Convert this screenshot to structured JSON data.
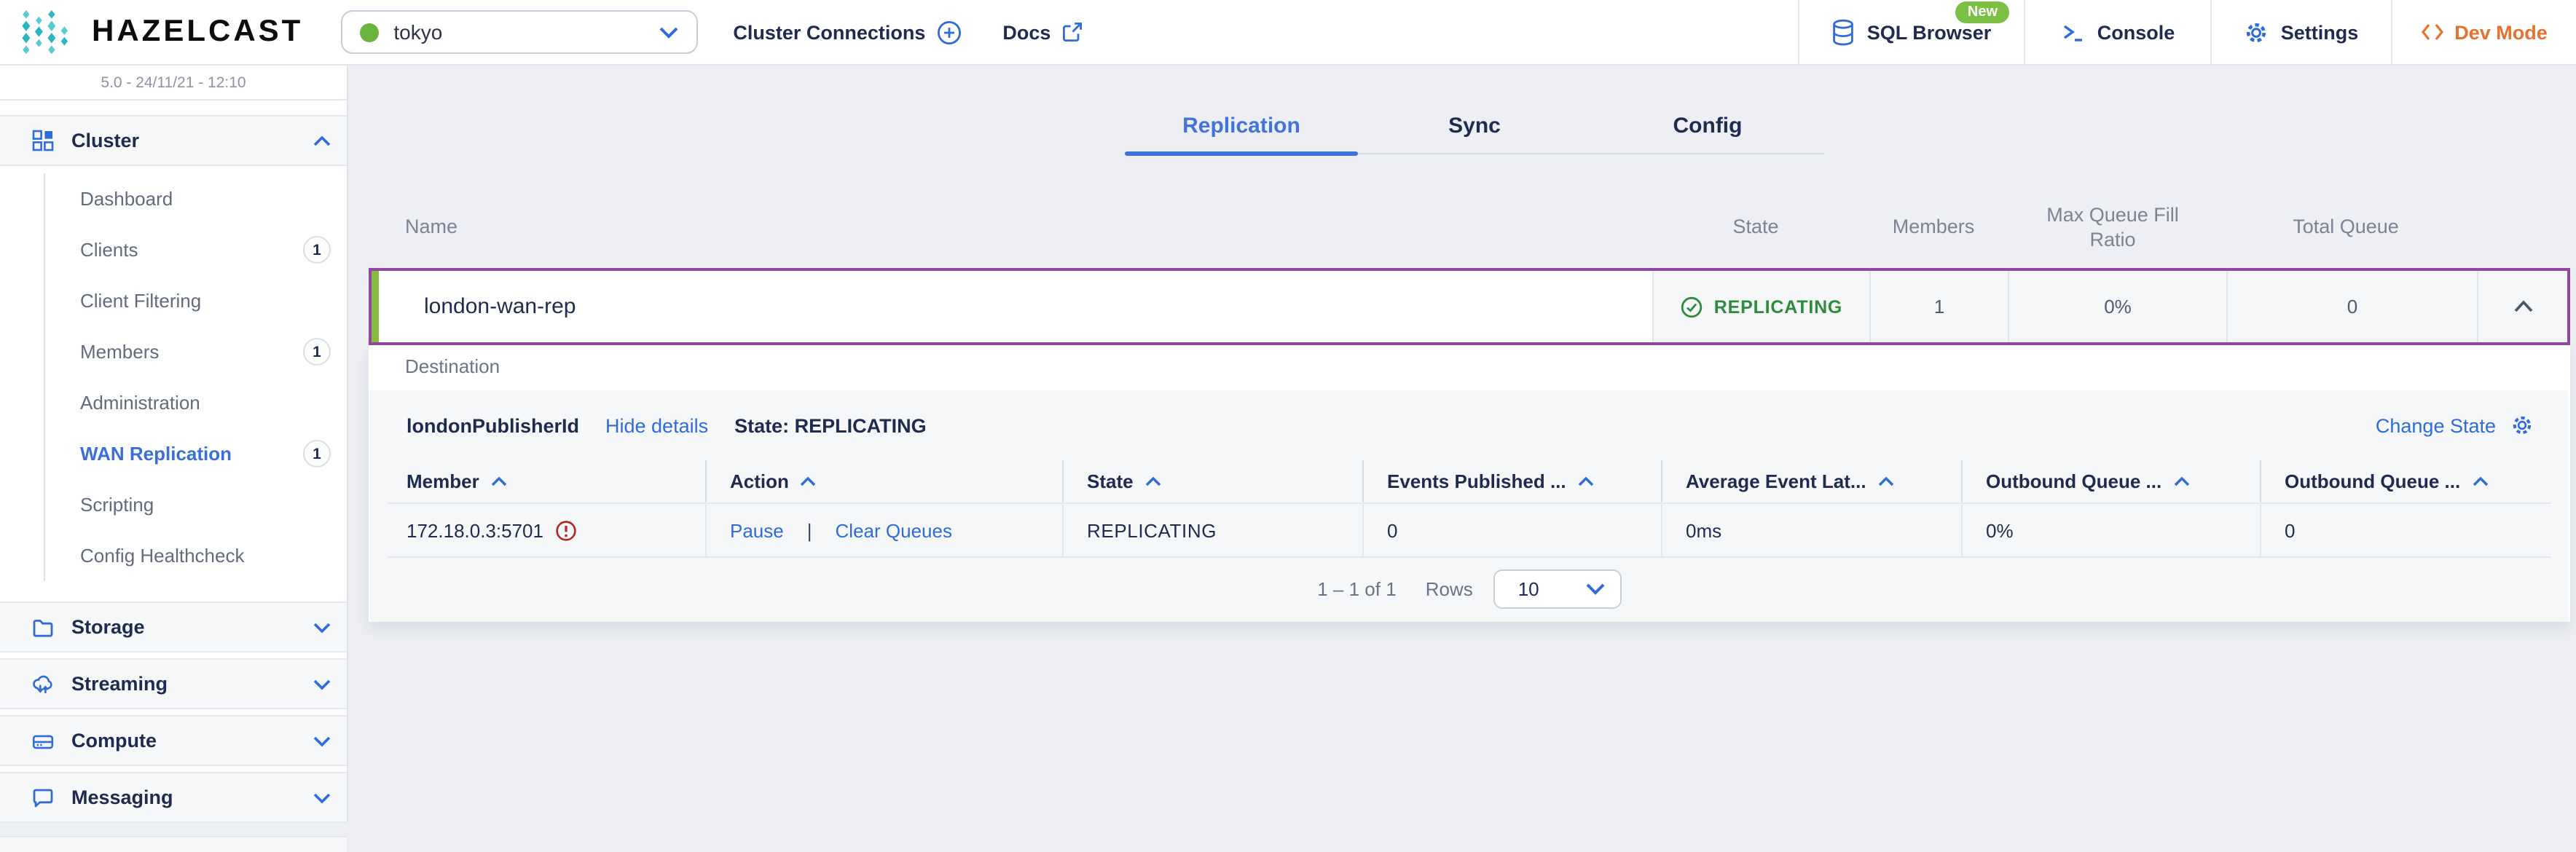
{
  "topbar": {
    "brand": "HAZELCAST",
    "cluster_selector": {
      "value": "tokyo",
      "status_color": "#6cb33e"
    },
    "cluster_connections": "Cluster Connections",
    "docs": "Docs",
    "actions": {
      "sql_browser": "SQL Browser",
      "sql_browser_badge": "New",
      "console": "Console",
      "settings": "Settings",
      "dev_mode": "Dev Mode"
    }
  },
  "sidebar": {
    "version": "5.0 - 24/11/21 - 12:10",
    "cluster_group": {
      "label": "Cluster",
      "items": [
        {
          "label": "Dashboard"
        },
        {
          "label": "Clients",
          "badge": "1"
        },
        {
          "label": "Client Filtering"
        },
        {
          "label": "Members",
          "badge": "1"
        },
        {
          "label": "Administration"
        },
        {
          "label": "WAN Replication",
          "badge": "1"
        },
        {
          "label": "Scripting"
        },
        {
          "label": "Config Healthcheck"
        }
      ]
    },
    "groups": [
      {
        "label": "Storage"
      },
      {
        "label": "Streaming"
      },
      {
        "label": "Compute"
      },
      {
        "label": "Messaging"
      }
    ]
  },
  "main": {
    "tabs": [
      {
        "label": "Replication"
      },
      {
        "label": "Sync"
      },
      {
        "label": "Config"
      }
    ],
    "table": {
      "headers": {
        "name": "Name",
        "state": "State",
        "members": "Members",
        "max_queue_fill_line1": "Max Queue Fill",
        "max_queue_fill_line2": "Ratio",
        "total_queue": "Total Queue"
      },
      "row": {
        "name": "london-wan-rep",
        "state": "REPLICATING",
        "members": "1",
        "max_queue_fill_ratio": "0%",
        "total_queue": "0"
      }
    },
    "details": {
      "destination_label": "Destination",
      "publisher": {
        "id": "londonPublisherId",
        "hide_details": "Hide details",
        "state_text": "State: REPLICATING",
        "change_state": "Change State"
      },
      "member_table": {
        "headers": [
          "Member",
          "Action",
          "State",
          "Events Published ...",
          "Average Event Lat...",
          "Outbound Queue ...",
          "Outbound Queue ..."
        ],
        "row": {
          "member": "172.18.0.3:5701",
          "action_pause": "Pause",
          "action_sep": "|",
          "action_clear": "Clear Queues",
          "state": "REPLICATING",
          "events_published": "0",
          "average_event_latency": "0ms",
          "outbound_queue_fill": "0%",
          "outbound_queue_size": "0"
        }
      },
      "pagination": {
        "range": "1 – 1 of 1",
        "rows_label": "Rows",
        "rows_per_page": "10"
      }
    }
  },
  "colors": {
    "accent_blue": "#2f6bd9",
    "active_tab_blue": "#4273d9",
    "replicating_green": "#2e8b3c",
    "status_dot_green": "#6cb33e",
    "row_strip_green": "#86ba40",
    "selected_row_purple": "#8e4a9e",
    "dev_mode_orange": "#e8722d",
    "warning_red": "#b3261e"
  }
}
